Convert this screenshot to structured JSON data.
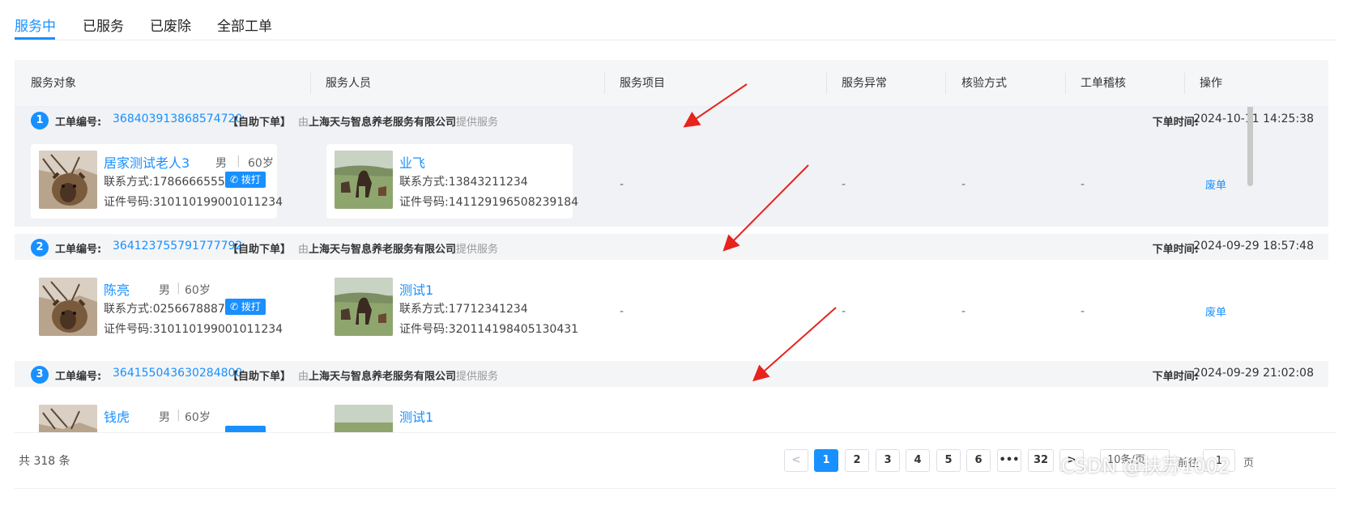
{
  "tabs": [
    {
      "label": "服务中",
      "active": true
    },
    {
      "label": "已服务",
      "active": false
    },
    {
      "label": "已废除",
      "active": false
    },
    {
      "label": "全部工单",
      "active": false
    }
  ],
  "columns": [
    "服务对象",
    "服务人员",
    "服务项目",
    "服务异常",
    "核验方式",
    "工单稽核",
    "操作"
  ],
  "labels": {
    "order_no": "工单编号:",
    "self_order": "【自助下单】",
    "by": "由",
    "provide": "提供服务",
    "order_time": "下单时间:",
    "contact": "联系方式:",
    "id_no": "证件号码:",
    "dial": "拨打",
    "void": "废单",
    "dash": "-",
    "sep": "|"
  },
  "orders": [
    {
      "index": "1",
      "id": "368403913868574720",
      "company": "上海天与智息养老服务有限公司",
      "time": "2024-10-11 14:25:38",
      "client": {
        "name": "居家测试老人3",
        "gender": "男",
        "age": "60岁",
        "phone": "17866665553",
        "id_no": "310110199001011234"
      },
      "staff": {
        "name": "业飞",
        "phone": "13843211234",
        "id_no": "141129196508239184"
      }
    },
    {
      "index": "2",
      "id": "364123755791777792",
      "company": "上海天与智息养老服务有限公司",
      "time": "2024-09-29 18:57:48",
      "client": {
        "name": "陈亮",
        "gender": "男",
        "age": "60岁",
        "phone": "02566788876",
        "id_no": "310110199001011234"
      },
      "staff": {
        "name": "测试1",
        "phone": "17712341234",
        "id_no": "320114198405130431"
      }
    },
    {
      "index": "3",
      "id": "364155043630284800",
      "company": "上海天与智息养老服务有限公司",
      "time": "2024-09-29 21:02:08",
      "client": {
        "name": "钱虎",
        "gender": "男",
        "age": "60岁"
      },
      "staff": {
        "name": "测试1"
      }
    }
  ],
  "pagination": {
    "total": "共 318 条",
    "prev": "<",
    "pages": [
      "1",
      "2",
      "3",
      "4",
      "5",
      "6",
      "•••",
      "32"
    ],
    "current": "1",
    "next": ">",
    "page_size": "10条/页",
    "goto_label": "前往",
    "goto_value": "1",
    "goto_unit": "页"
  },
  "watermark": "CSDN @扶苏1002",
  "colors": {
    "accent": "#1890ff",
    "arrow": "#e8221c"
  }
}
